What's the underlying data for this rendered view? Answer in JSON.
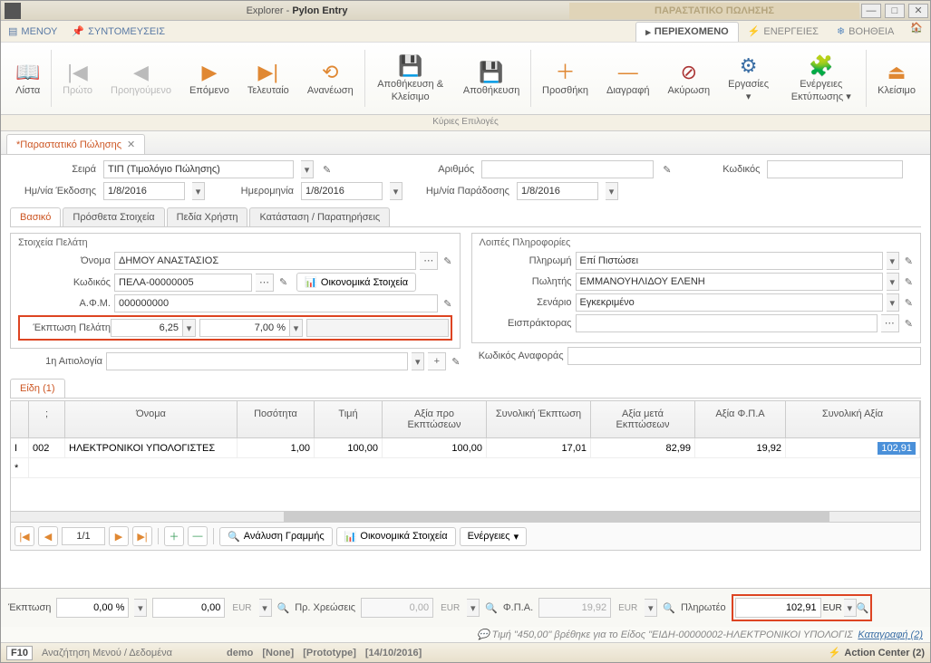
{
  "titlebar": {
    "app": "Explorer",
    "sub": "Pylon Entry",
    "sale_header": "ΠΑΡΑΣΤΑΤΙΚΟ ΠΩΛΗΣΗΣ"
  },
  "menubar": {
    "menu": "ΜΕΝΟΥ",
    "shortcuts": "ΣΥΝΤΟΜΕΥΣΕΙΣ"
  },
  "topright": {
    "content": "ΠΕΡΙΕΧΟΜΕΝΟ",
    "actions": "ΕΝΕΡΓΕΙΕΣ",
    "help": "ΒΟΗΘΕΙΑ"
  },
  "ribbon": {
    "list": "Λίστα",
    "first": "Πρώτο",
    "prev": "Προηγούμενο",
    "next": "Επόμενο",
    "last": "Τελευταίο",
    "refresh": "Ανανέωση",
    "saveclose": "Αποθήκευση & Κλείσιμο",
    "save": "Αποθήκευση",
    "add": "Προσθήκη",
    "delete": "Διαγραφή",
    "cancel": "Ακύρωση",
    "works": "Εργασίες",
    "printactions": "Ενέργειες Εκτύπωσης",
    "close": "Κλείσιμο",
    "footer": "Κύριες Επιλογές"
  },
  "doc_tab": {
    "title": "*Παραστατικό Πώλησης"
  },
  "header": {
    "series_lbl": "Σειρά",
    "series_val": "ΤΙΠ (Τιμολόγιο Πώλησης)",
    "number_lbl": "Αριθμός",
    "number_val": "",
    "code_lbl": "Κωδικός",
    "code_val": "",
    "issue_date_lbl": "Ημ/νία Έκδοσης",
    "issue_date": "1/8/2016",
    "date_lbl": "Ημερομηνία",
    "date": "1/8/2016",
    "delivery_date_lbl": "Ημ/νία Παράδοσης",
    "delivery_date": "1/8/2016"
  },
  "subtabs": {
    "basic": "Βασικό",
    "extra": "Πρόσθετα Στοιχεία",
    "userfields": "Πεδία Χρήστη",
    "status": "Κατάσταση / Παρατηρήσεις"
  },
  "customer": {
    "legend": "Στοιχεία Πελάτη",
    "name_lbl": "Όνομα",
    "name": "ΔΗΜΟΥ ΑΝΑΣΤΑΣΙΟΣ",
    "code_lbl": "Κωδικός",
    "code": "ΠΕΛΑ-00000005",
    "fin_btn": "Οικονομικά Στοιχεία",
    "afm_lbl": "Α.Φ.Μ.",
    "afm": "000000000",
    "disc_lbl": "Έκπτωση Πελάτη",
    "disc1": "6,25",
    "disc2": "7,00 %",
    "reason_lbl": "1η Αιτιολογία",
    "reason": ""
  },
  "other": {
    "legend": "Λοιπές Πληροφορίες",
    "pay_lbl": "Πληρωμή",
    "pay": "Επί Πιστώσει",
    "seller_lbl": "Πωλητής",
    "seller": "ΕΜΜΑΝΟΥΗΛΙΔΟΥ ΕΛΕΝΗ",
    "scenario_lbl": "Σενάριο",
    "scenario": "Εγκεκριμένο",
    "collector_lbl": "Εισπράκτορας",
    "collector": "",
    "refcode_lbl": "Κωδικός Αναφοράς",
    "refcode": ""
  },
  "items_tab": "Είδη (1)",
  "grid": {
    "cols": {
      "code": ";",
      "name": "Όνομα",
      "qty": "Ποσότητα",
      "price": "Τιμή",
      "pre": "Αξία προ Εκπτώσεων",
      "disc": "Συνολική Έκπτωση",
      "post": "Αξία μετά Εκπτώσεων",
      "vat": "Αξία Φ.Π.Α",
      "total": "Συνολική Αξία"
    },
    "row": {
      "marker": "I",
      "code": "002",
      "name": "ΗΛΕΚΤΡΟΝΙΚΟΙ ΥΠΟΛΟΓΙΣΤΕΣ",
      "qty": "1,00",
      "price": "100,00",
      "pre": "100,00",
      "disc": "17,01",
      "post": "82,99",
      "vat": "19,92",
      "total": "102,91"
    },
    "newrow": "*"
  },
  "gridnav": {
    "page": "1/1",
    "analyze": "Ανάλυση Γραμμής",
    "fin": "Οικονομικά Στοιχεία",
    "actions": "Ενέργειες"
  },
  "totals": {
    "disc_lbl": "Έκπτωση",
    "disc_pct": "0,00 %",
    "disc_amt": "0,00",
    "prev_lbl": "Πρ. Χρεώσεις",
    "prev": "0,00",
    "vat_lbl": "Φ.Π.Α.",
    "vat": "19,92",
    "payable_lbl": "Πληρωτέο",
    "payable": "102,91",
    "cur": "EUR"
  },
  "info": {
    "msg": "Τιμή \"450,00\" βρέθηκε για το Είδος \"ΕΙΔΗ-00000002-ΗΛΕΚΤΡΟΝΙΚΟΙ ΥΠΟΛΟΓΙΣ",
    "log": "Καταγραφή (2)"
  },
  "status": {
    "f10": "F10",
    "search": "Αναζήτηση Μενού / Δεδομένα",
    "demo": "demo",
    "none": "[None]",
    "proto": "[Prototype]",
    "date": "[14/10/2016]",
    "action_center": "Action Center (2)"
  }
}
